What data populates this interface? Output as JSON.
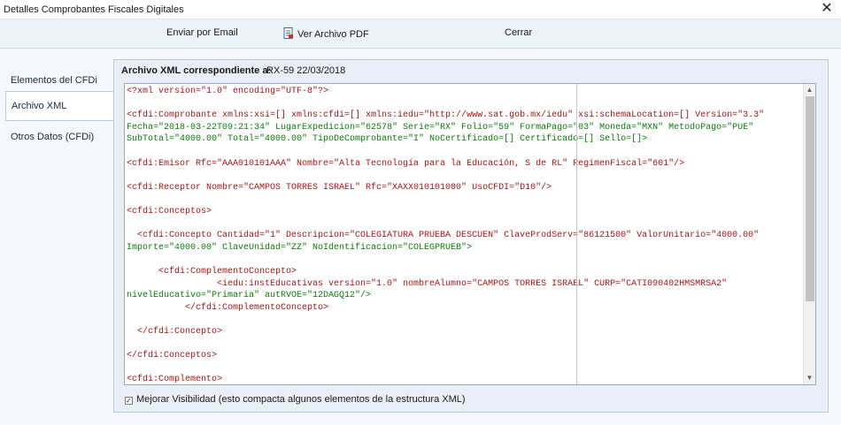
{
  "window": {
    "title": "Detalles Comprobantes Fiscales Digitales",
    "close_glyph": "✕"
  },
  "toolbar": {
    "email_label": "Enviar por Email",
    "pdf_label": "Ver Archivo PDF",
    "close_label": "Cerrar"
  },
  "nav": {
    "items": [
      {
        "label": "Elementos del CFDi"
      },
      {
        "label": "Archivo XML"
      },
      {
        "label": "Otros Datos (CFDi)"
      }
    ]
  },
  "panel": {
    "heading": "Archivo XML correspondiente a:",
    "value": "RX-59 22/03/2018"
  },
  "xml": {
    "line1": "<?xml version=\"1.0\" encoding=\"UTF-8\"?>",
    "comprobante_line1": "<cfdi:Comprobante xmlns:xsi=[] xmlns:cfdi=[] xmlns:iedu=\"http://www.sat.gob.mx/iedu\" xsi:schemaLocation=[] Version=\"3.3\"",
    "comprobante_line2": "Fecha=\"2018-03-22T09:21:34\" LugarExpedicion=\"62578\" Serie=\"RX\" Folio=\"59\" FormaPago=\"03\" Moneda=\"MXN\" MetodoPago=\"PUE\"",
    "comprobante_line3": "SubTotal=\"4000.00\" Total=\"4000.00\" TipoDeComprobante=\"I\" NoCertificado=[] Certificado=[] Sello=[]>",
    "emisor": "<cfdi:Emisor Rfc=\"AAA010101AAA\" Nombre=\"Alta Tecnología para la Educación, S de RL\" RegimenFiscal=\"601\"/>",
    "receptor": "<cfdi:Receptor Nombre=\"CAMPOS TORRES ISRAEL\" Rfc=\"XAXX010101000\" UsoCFDI=\"D10\"/>",
    "conceptos_open": "<cfdi:Conceptos>",
    "concepto_line1": "  <cfdi:Concepto Cantidad=\"1\" Descripcion=\"COLEGIATURA PRUEBA DESCUEN\" ClaveProdServ=\"86121500\" ValorUnitario=\"4000.00\"",
    "concepto_line2": "Importe=\"4000.00\" ClaveUnidad=\"ZZ\" NoIdentificacion=\"COLEGPRUEB\">",
    "complemento_concepto_open": "      <cfdi:ComplementoConcepto>",
    "iedu_line1": "                 <iedu:instEducativas version=\"1.0\" nombreAlumno=\"CAMPOS TORRES ISRAEL\" CURP=\"CATI090402HMSMRSA2\"",
    "iedu_line2": "nivelEducativo=\"Primaria\" autRVOE=\"12DAGQ12\"/>",
    "complemento_concepto_close": "           </cfdi:ComplementoConcepto>",
    "concepto_close": "  </cfdi:Concepto>",
    "conceptos_close": "</cfdi:Conceptos>",
    "complemento_open": "<cfdi:Complemento>"
  },
  "checkbox": {
    "checked_glyph": "✓",
    "label": "Mejorar Visibilidad (esto compacta algunos elementos de la estructura XML)"
  },
  "colors": {
    "tag": "#a31515",
    "attribute": "#0a7a0a",
    "value": "#0000ff"
  },
  "icons": {
    "pdf": "pdf-document-icon",
    "close": "close-icon",
    "scroll_up": "scroll-up-arrow-icon",
    "scroll_down": "scroll-down-arrow-icon"
  }
}
